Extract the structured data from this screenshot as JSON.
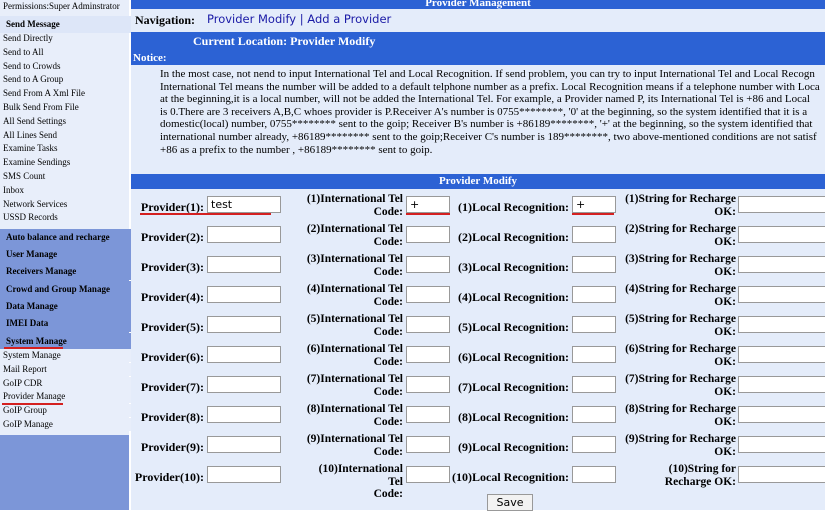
{
  "sidebar": {
    "permissions": "Permissions:Super Adminstrator",
    "send_message_head": "Send Message",
    "send_items": [
      "Send Directly",
      "Send to All",
      "Send to Crowds",
      "Send to A Group",
      "Send From A Xml File",
      "Bulk Send From File",
      "All Send Settings",
      "All Lines Send",
      "Examine Tasks",
      "Examine Sendings",
      "SMS Count",
      "Inbox",
      "Network Services",
      "USSD Records"
    ],
    "sections": [
      "Auto balance and recharge",
      "User Manage",
      "Receivers Manage",
      "Crowd and Group Manage",
      "Data Manage",
      "IMEI Data",
      "System Manage"
    ],
    "system_items": [
      "System Manage",
      "Mail Report",
      "GoIP CDR",
      "Provider Manage",
      "GoIP Group",
      "GoIP Manage"
    ]
  },
  "header": {
    "title": "Provider Management"
  },
  "nav": {
    "label": "Navigation:",
    "link1": "Provider Modify",
    "separator": "|",
    "link2": "Add a Provider"
  },
  "location": {
    "title": "Current Location: Provider Modify"
  },
  "notice": {
    "title": "Notice:",
    "lines": [
      "In the most case, not nend to input International Tel and Local Recognition. If send problem, you can try to input International Tel and Local Recogn",
      "International Tel means the number will be added to a default telphone number as a prefix. Local Recognition means if a telephone number with Loca",
      "at the beginning,it is a local number, will not be added the International Tel. For example, a Provider named P, its International Tel is +86 and Local",
      "is 0.There are 3 receivers A,B,C whoes provider is P.Receiver A's number is 0755********, '0' at the beginning, so the system identified that it is a",
      "domestic(local) number, 0755******** sent to the goip; Receiver B's number is +86189********, '+' at the beginning, so the system identified that",
      "international number already, +86189******** sent to the goip;Receiver C's number is 189********, two above-mentioned conditions are not satisf",
      "+86 as a prefix to the number , +86189******** sent to goip."
    ]
  },
  "provider_modify": {
    "title": "Provider Modify",
    "rows": [
      {
        "provider_label": "Provider(1):",
        "provider": "test",
        "intl_label_a": "(1)International Tel",
        "intl_label_b": "Code:",
        "intl": "+",
        "local_label": "(1)Local Recognition:",
        "local": "+",
        "recharge_label_a": "(1)String for Recharge",
        "recharge_label_b": "OK:",
        "recharge": ""
      },
      {
        "provider_label": "Provider(2):",
        "provider": "",
        "intl_label_a": "(2)International Tel",
        "intl_label_b": "Code:",
        "intl": "",
        "local_label": "(2)Local Recognition:",
        "local": "",
        "recharge_label_a": "(2)String for Recharge",
        "recharge_label_b": "OK:",
        "recharge": ""
      },
      {
        "provider_label": "Provider(3):",
        "provider": "",
        "intl_label_a": "(3)International Tel",
        "intl_label_b": "Code:",
        "intl": "",
        "local_label": "(3)Local Recognition:",
        "local": "",
        "recharge_label_a": "(3)String for Recharge",
        "recharge_label_b": "OK:",
        "recharge": ""
      },
      {
        "provider_label": "Provider(4):",
        "provider": "",
        "intl_label_a": "(4)International Tel",
        "intl_label_b": "Code:",
        "intl": "",
        "local_label": "(4)Local Recognition:",
        "local": "",
        "recharge_label_a": "(4)String for Recharge",
        "recharge_label_b": "OK:",
        "recharge": ""
      },
      {
        "provider_label": "Provider(5):",
        "provider": "",
        "intl_label_a": "(5)International Tel",
        "intl_label_b": "Code:",
        "intl": "",
        "local_label": "(5)Local Recognition:",
        "local": "",
        "recharge_label_a": "(5)String for Recharge",
        "recharge_label_b": "OK:",
        "recharge": ""
      },
      {
        "provider_label": "Provider(6):",
        "provider": "",
        "intl_label_a": "(6)International Tel",
        "intl_label_b": "Code:",
        "intl": "",
        "local_label": "(6)Local Recognition:",
        "local": "",
        "recharge_label_a": "(6)String for Recharge",
        "recharge_label_b": "OK:",
        "recharge": ""
      },
      {
        "provider_label": "Provider(7):",
        "provider": "",
        "intl_label_a": "(7)International Tel",
        "intl_label_b": "Code:",
        "intl": "",
        "local_label": "(7)Local Recognition:",
        "local": "",
        "recharge_label_a": "(7)String for Recharge",
        "recharge_label_b": "OK:",
        "recharge": ""
      },
      {
        "provider_label": "Provider(8):",
        "provider": "",
        "intl_label_a": "(8)International Tel",
        "intl_label_b": "Code:",
        "intl": "",
        "local_label": "(8)Local Recognition:",
        "local": "",
        "recharge_label_a": "(8)String for Recharge",
        "recharge_label_b": "OK:",
        "recharge": ""
      },
      {
        "provider_label": "Provider(9):",
        "provider": "",
        "intl_label_a": "(9)International Tel",
        "intl_label_b": "Code:",
        "intl": "",
        "local_label": "(9)Local Recognition:",
        "local": "",
        "recharge_label_a": "(9)String for Recharge",
        "recharge_label_b": "OK:",
        "recharge": ""
      },
      {
        "provider_label": "Provider(10):",
        "provider": "",
        "intl_label_a": "(10)International Tel",
        "intl_label_b": "Code:",
        "intl": "",
        "local_label": "(10)Local Recognition:",
        "local": "",
        "recharge_label_a": "(10)String for",
        "recharge_label_b": "Recharge OK:",
        "recharge": ""
      }
    ],
    "save_label": "Save"
  }
}
